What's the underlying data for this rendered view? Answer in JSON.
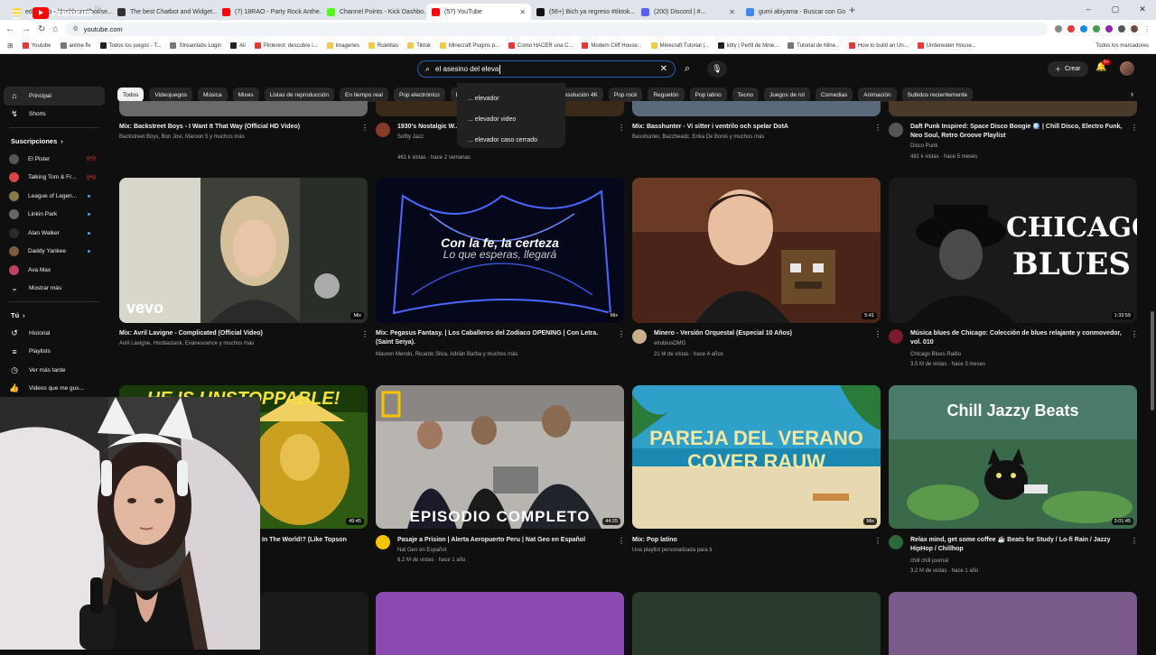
{
  "browser": {
    "tabs": [
      {
        "title": "ed-bot.com/dashboard/bot/se...",
        "color": "#ffd54f",
        "active": false
      },
      {
        "title": "The best Chatbot and Widget...",
        "color": "#333333",
        "active": false
      },
      {
        "title": "(7) 18RAO - Party Rock Anthe...",
        "color": "#ff0000",
        "active": false
      },
      {
        "title": "Channel Points - Kick Dashbo...",
        "color": "#53fc18",
        "active": false
      },
      {
        "title": "(57) YouTube",
        "color": "#ff0000",
        "active": true
      },
      {
        "title": "(56+) Bich ya regreso #tiktok...",
        "color": "#111111",
        "active": false
      },
      {
        "title": "(200) Discord | #...",
        "color": "#5865f2",
        "active": false
      },
      {
        "title": "gumi abiyama - Buscar con Go...",
        "color": "#4285f4",
        "active": false
      }
    ],
    "url": "youtube.com",
    "bookmarks": [
      {
        "label": "Youtube",
        "kind": "red"
      },
      {
        "label": "anime flv",
        "kind": "grey"
      },
      {
        "label": "Todos los juegos - T...",
        "kind": "dark"
      },
      {
        "label": "Streamlabs Login",
        "kind": "grey"
      },
      {
        "label": "Ali",
        "kind": "dark"
      },
      {
        "label": "Pinterest: descubre i...",
        "kind": "red"
      },
      {
        "label": "Imagenes",
        "kind": "folder"
      },
      {
        "label": "Ruletitas",
        "kind": "folder"
      },
      {
        "label": "Tiktok",
        "kind": "folder"
      },
      {
        "label": "Minecraft Plugins p...",
        "kind": "folder"
      },
      {
        "label": "Como HACER una C...",
        "kind": "red"
      },
      {
        "label": "Modern Cliff House...",
        "kind": "red"
      },
      {
        "label": "Minecraft Tutorial |...",
        "kind": "folder"
      },
      {
        "label": "kitty | Perfil de Mine...",
        "kind": "dark"
      },
      {
        "label": "Tutorial de Mine...",
        "kind": "grey"
      },
      {
        "label": "How to build an Un...",
        "kind": "red"
      },
      {
        "label": "Underwater House...",
        "kind": "red"
      }
    ],
    "all_bookmarks": "Todos los marcadores"
  },
  "youtube": {
    "logo_text": "Premium",
    "logo_country": "PE",
    "search": {
      "query": "el asesino del eleva",
      "suggestions": [
        "... elevador",
        "... elevador video",
        "... elevador caso cerrado"
      ]
    },
    "create_label": "Crear",
    "notif_count": "9+",
    "chips": [
      "Todos",
      "Videojuegos",
      "Música",
      "Mixes",
      "Listas de reproducción",
      "En tiempo real",
      "Pop electrónico",
      "Hip hop old-school",
      "Álbumes",
      "Resolución 4K",
      "Pop rock",
      "Reguetón",
      "Pop latino",
      "Tecno",
      "Juegos de rol",
      "Comedias",
      "Animación",
      "Subidos recientemente"
    ],
    "sidebar": {
      "main": [
        {
          "label": "Principal",
          "icon": "home-icon"
        },
        {
          "label": "Shorts",
          "icon": "shorts-icon"
        }
      ],
      "subs_header": "Suscripciones",
      "subs": [
        {
          "label": "El Pister",
          "color": "#555555",
          "marker": "live"
        },
        {
          "label": "Talking Tom & Fr...",
          "color": "#d64545",
          "marker": "live"
        },
        {
          "label": "League of Legen...",
          "color": "#8a7a4a",
          "marker": "dot"
        },
        {
          "label": "Linkin Park",
          "color": "#666666",
          "marker": "dot"
        },
        {
          "label": "Alan Walker",
          "color": "#2a2a2a",
          "marker": "dot"
        },
        {
          "label": "Daddy Yankee",
          "color": "#7a5a40",
          "marker": "dot"
        },
        {
          "label": "Ava Max",
          "color": "#c04060",
          "marker": "none"
        }
      ],
      "show_more": "Mostrar más",
      "you_header": "Tú",
      "you": [
        {
          "label": "Historial",
          "icon": "history-icon"
        },
        {
          "label": "Playlists",
          "icon": "playlists-icon"
        },
        {
          "label": "Ver más tarde",
          "icon": "clock-icon"
        },
        {
          "label": "Videos que me gus...",
          "icon": "like-icon"
        }
      ]
    },
    "row0": [
      {
        "title": "Mix: Backstreet Boys - I Want It That Way (Official HD Video)",
        "meta1": "Backstreet Boys, Bon Jovi, Maroon 5 y muchos más",
        "meta2": ""
      },
      {
        "title": "1930's Nostalgic W...                          Jazz Vibes",
        "meta1": "Softly Jazz",
        "meta2": "461 k vistas · hace 2 semanas"
      },
      {
        "title": "Mix: Basshunter - Vi sitter i ventrilo och spelar DotA",
        "meta1": "Basshunter, Bazzheadz, Erika De Bonis y muchos más",
        "meta2": ""
      },
      {
        "title": "Daft Punk Inspired: Space Disco Boogie 🪩 | Chill Disco, Electro Funk, Neo Soul, Retro Groove Playlist",
        "meta1": "Disco Punk",
        "meta2": "481 k vistas · hace 5 meses"
      }
    ],
    "row1": [
      {
        "title": "Mix: Avril Lavigne - Complicated (Official Video)",
        "meta1": "Avril Lavigne, Hoobastank, Evanescence y muchos más",
        "meta2": "",
        "duration": "Mix",
        "overlay": "vevo"
      },
      {
        "title": "Mix: Pegasus Fantasy. | Los Caballeros del Zodiaco OPENING | Con Letra. (Saint Seiya).",
        "meta1": "Mauren Mendo, Ricardo Silva, Adrián Barba y muchos más",
        "meta2": "",
        "duration": "Mix",
        "overlay1": "Con la fe, la certeza",
        "overlay2": "Lo que esperas, llegará"
      },
      {
        "title": "Minero - Versión Orquestal (Especial 10 Años)",
        "meta1": "elrubiusOMG",
        "meta2": "21 M de vistas · hace 4 años",
        "duration": "5:41"
      },
      {
        "title": "Música blues de Chicago: Colección de blues relajante y conmovedor, vol. 010",
        "meta1": "Chicago Blues Radio",
        "meta2": "3.5 M de vistas · hace 3 meses",
        "duration": "1:33:59",
        "overlay1": "CHICAGO",
        "overlay2": "BLUES"
      }
    ],
    "row2": [
      {
        "title": "In The World!? (Like Topson",
        "meta1": "",
        "meta2": "",
        "duration": "49:45",
        "overlay1": "HE IS UNSTOPPABLE!"
      },
      {
        "title": "Pasaje a Prision | Alerta Aeropuerto Peru | Nat Geo en Español",
        "meta1": "Nat Geo en Español",
        "meta2": "6.2 M de vistas · hace 1 año",
        "duration": "44:25",
        "overlay1": "EPISODIO COMPLETO"
      },
      {
        "title": "Mix: Pop latino",
        "meta1": "Una playlist personalizada para ti",
        "meta2": "",
        "duration": "Mix",
        "overlay1": "PAREJA DEL VERANO",
        "overlay2": "COVER RAUW"
      },
      {
        "title": "Relax mind, get some coffee ☕ Beats for Study / Lo-fi Rain / Jazzy HipHop / Chillhop",
        "meta1": "chill chill journal",
        "meta2": "3.2 M de vistas · hace 1 año",
        "duration": "3:01:45",
        "overlay1": "Chill Jazzy Beats"
      }
    ]
  }
}
